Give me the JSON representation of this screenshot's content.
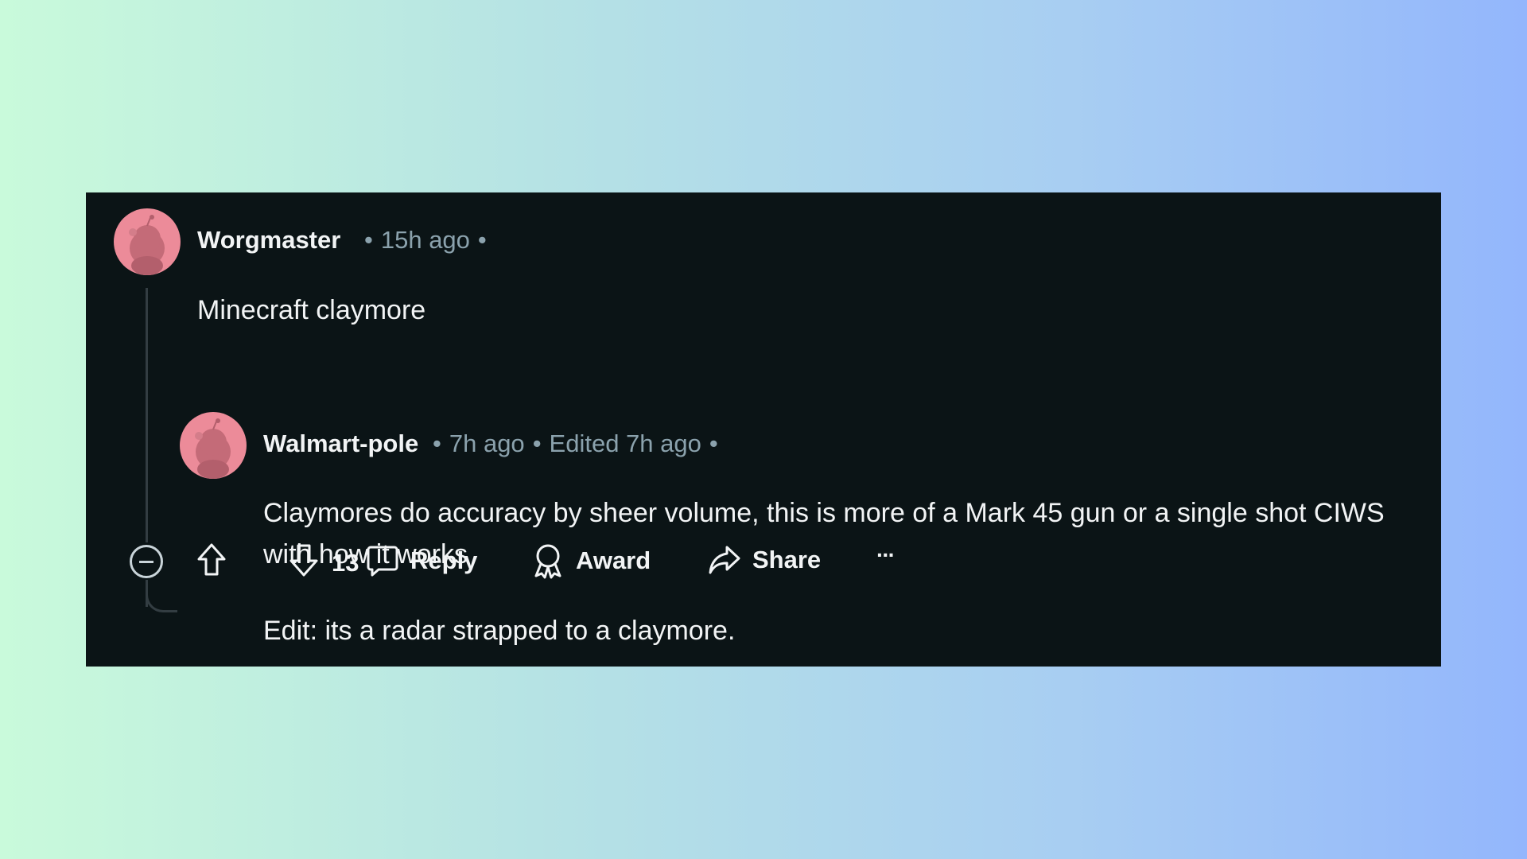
{
  "comment": {
    "author": "Worgmaster",
    "time": "15h ago",
    "body": "Minecraft claymore",
    "votes": "13",
    "actions": {
      "reply": "Reply",
      "award": "Award",
      "share": "Share",
      "more": "···"
    }
  },
  "reply": {
    "author": "Walmart-pole",
    "time": "7h ago",
    "edited": "Edited 7h ago",
    "body_p1": "Claymores do accuracy by sheer volume, this is more of a Mark 45 gun or a single shot CIWS with how it works",
    "body_p2": "Edit: its a radar strapped to a claymore."
  },
  "colors": {
    "panel_bg": "#0b1416",
    "avatar_bg": "#ec8b99",
    "meta_text": "#8ba2ad"
  },
  "icons": [
    "avatar-icon",
    "minus-circle-icon",
    "upvote-arrow-icon",
    "downvote-arrow-icon",
    "comment-bubble-icon",
    "award-ribbon-icon",
    "share-arrow-icon",
    "ellipsis-icon"
  ]
}
